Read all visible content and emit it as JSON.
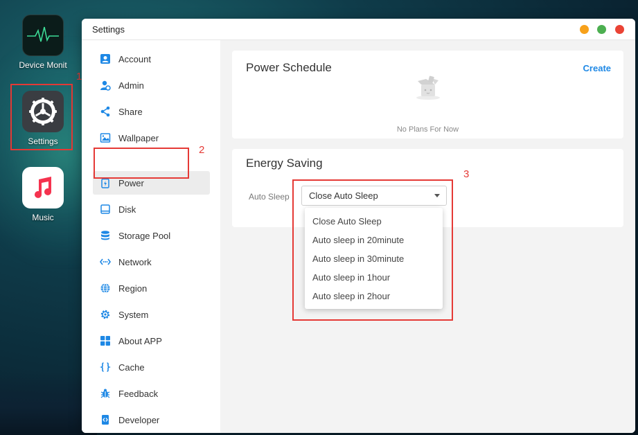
{
  "desktop": {
    "icons": [
      {
        "label": "Device Monit"
      },
      {
        "label": "Settings"
      },
      {
        "label": "Music"
      }
    ]
  },
  "annotations": [
    "1",
    "2",
    "3"
  ],
  "window": {
    "title": "Settings",
    "controls": {
      "minimize_color": "#f7a11a",
      "maximize_color": "#4caf50",
      "close_color": "#ea4335"
    }
  },
  "sidebar": {
    "items": [
      {
        "label": "Account",
        "icon": "account-icon"
      },
      {
        "label": "Admin",
        "icon": "admin-icon"
      },
      {
        "label": "Share",
        "icon": "share-icon"
      },
      {
        "label": "Wallpaper",
        "icon": "wallpaper-icon"
      },
      {
        "label": "Power",
        "icon": "power-icon",
        "active": true
      },
      {
        "label": "Disk",
        "icon": "disk-icon"
      },
      {
        "label": "Storage Pool",
        "icon": "storage-pool-icon"
      },
      {
        "label": "Network",
        "icon": "network-icon"
      },
      {
        "label": "Region",
        "icon": "globe-icon"
      },
      {
        "label": "System",
        "icon": "gear-icon"
      },
      {
        "label": "About APP",
        "icon": "grid-icon"
      },
      {
        "label": "Cache",
        "icon": "braces-icon"
      },
      {
        "label": "Feedback",
        "icon": "bug-icon"
      },
      {
        "label": "Developer",
        "icon": "code-icon"
      }
    ]
  },
  "power_schedule": {
    "title": "Power Schedule",
    "create_label": "Create",
    "empty_text": "No Plans For Now"
  },
  "energy_saving": {
    "title": "Energy Saving",
    "auto_sleep_label": "Auto Sleep",
    "selected": "Close Auto Sleep",
    "options": [
      "Close Auto Sleep",
      "Auto sleep in 20minute",
      "Auto sleep in 30minute",
      "Auto sleep in 1hour",
      "Auto sleep in 2hour"
    ]
  },
  "colors": {
    "accent": "#1e88e5",
    "annotation": "#e53935",
    "icon_blue": "#1e88e5"
  }
}
